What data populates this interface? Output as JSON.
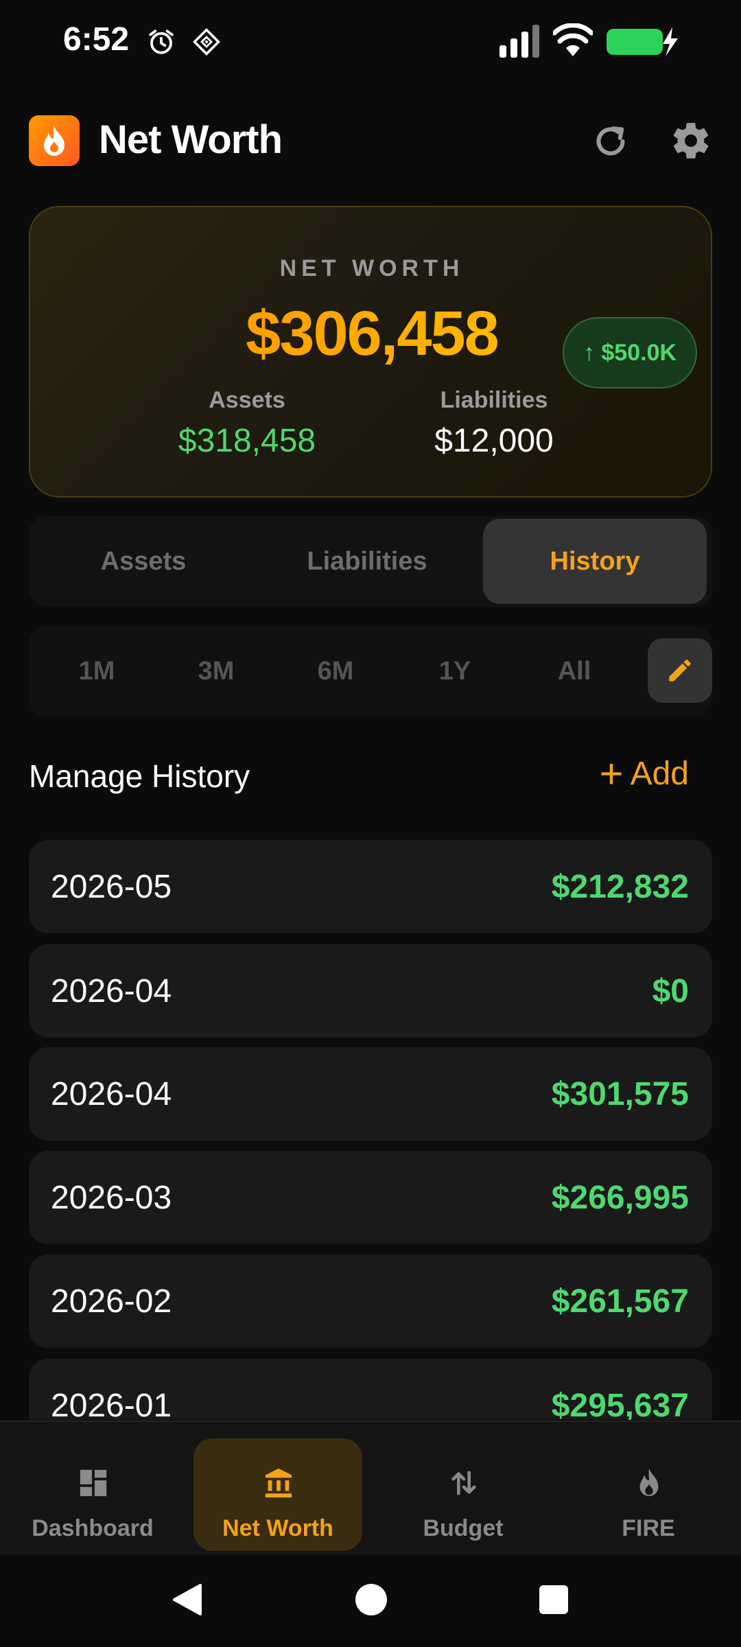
{
  "status_bar": {
    "time": "6:52"
  },
  "header": {
    "title": "Net Worth"
  },
  "net_worth": {
    "label": "NET WORTH",
    "value": "$306,458",
    "change": "↑ $50.0K",
    "assets_label": "Assets",
    "assets_value": "$318,458",
    "liabilities_label": "Liabilities",
    "liabilities_value": "$12,000"
  },
  "tabs": [
    {
      "label": "Assets",
      "active": false
    },
    {
      "label": "Liabilities",
      "active": false
    },
    {
      "label": "History",
      "active": true
    }
  ],
  "ranges": [
    "1M",
    "3M",
    "6M",
    "1Y",
    "All"
  ],
  "history": {
    "title": "Manage History",
    "add_label": "Add",
    "entries": [
      {
        "date": "2026-05",
        "amount": "$212,832"
      },
      {
        "date": "2026-04",
        "amount": "$0"
      },
      {
        "date": "2026-04",
        "amount": "$301,575"
      },
      {
        "date": "2026-03",
        "amount": "$266,995"
      },
      {
        "date": "2026-02",
        "amount": "$261,567"
      },
      {
        "date": "2026-01",
        "amount": "$295,637"
      }
    ]
  },
  "bottom_nav": [
    {
      "label": "Dashboard",
      "icon": "dashboard-icon",
      "active": false
    },
    {
      "label": "Net Worth",
      "icon": "bank-icon",
      "active": true
    },
    {
      "label": "Budget",
      "icon": "swap-vertical-icon",
      "active": false
    },
    {
      "label": "FIRE",
      "icon": "flame-icon",
      "active": false
    }
  ],
  "colors": {
    "accent": "#f5a21b",
    "positive": "#4fd870",
    "background": "#0b0b0b",
    "card": "#1a1a1a"
  }
}
